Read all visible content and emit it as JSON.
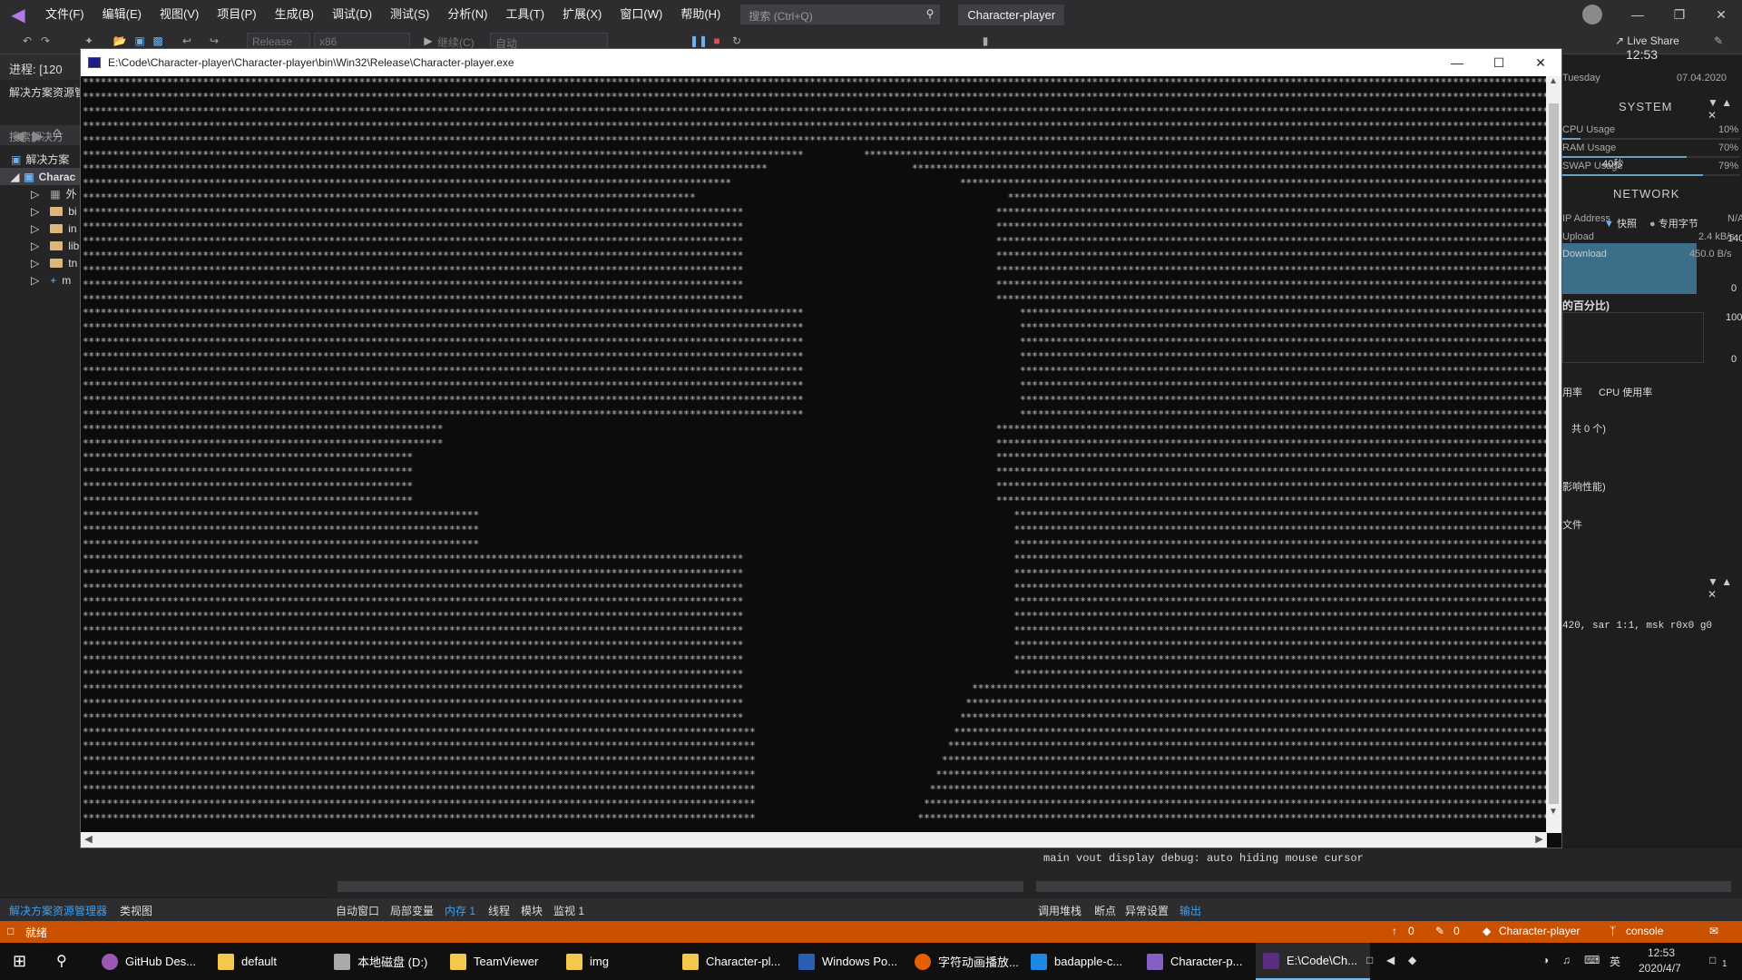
{
  "vs": {
    "menu": [
      "文件(F)",
      "编辑(E)",
      "视图(V)",
      "项目(P)",
      "生成(B)",
      "调试(D)",
      "测试(S)",
      "分析(N)",
      "工具(T)",
      "扩展(X)",
      "窗口(W)",
      "帮助(H)"
    ],
    "search_placeholder": "搜索 (Ctrl+Q)",
    "app_title": "Character-player",
    "live_share": "Live Share",
    "toolbar": {
      "config": "Release",
      "platform": "x86",
      "continue": "继续(C)",
      "auto": "自动"
    },
    "process_label": "进程:",
    "process_value": "[120",
    "solution": {
      "header": "解决方案资源管",
      "search": "搜索解决方",
      "items": [
        "解决方案",
        "Charac",
        "外",
        "bi",
        "in",
        "lib",
        "tn",
        "m"
      ]
    },
    "bottom_left_tabs": [
      "解决方案资源管理器",
      "类视图"
    ],
    "bottom_mid_tabs": [
      "自动窗口",
      "局部变量",
      "内存 1",
      "线程",
      "模块",
      "监视 1"
    ],
    "bottom_right_tabs": [
      "调用堆栈",
      "断点",
      "异常设置",
      "输出"
    ],
    "output_lines": [
      "main vout display debug: auto hiding mouse cursor"
    ],
    "status": {
      "ready": "就绪",
      "up": "0",
      "edit": "0",
      "project": "Character-player",
      "branch": "console"
    }
  },
  "console": {
    "title": "E:\\Code\\Character-player\\Character-player\\bin\\Win32\\Release\\Character-player.exe",
    "char": "*"
  },
  "rainmeter": {
    "time": "12:53",
    "day": "Tuesday",
    "date": "07.04.2020",
    "system_title": "SYSTEM",
    "cpu_label": "CPU Usage",
    "cpu_value": "10%",
    "ram_label": "RAM Usage",
    "ram_value": "70%",
    "swap_label": "SWAP Usage",
    "swap_value": "79%",
    "swap_extra": "40秒",
    "network_title": "NETWORK",
    "ip_label": "IP Address",
    "ip_value": "N/A",
    "snap": "快照",
    "bytes": "专用字节",
    "upload_label": "Upload",
    "upload_value": "2.4 kB/s",
    "upload_scale": "140",
    "download_label": "Download",
    "download_value": "450.0 B/s",
    "zero1": "0",
    "percent_title": "的百分比)",
    "hundred": "100",
    "zero2": "0",
    "usage1": "用率",
    "usage2": "CPU 使用率",
    "count": "共 0 个)",
    "impact": "影响性能)",
    "file": "文件",
    "diag_text": "420, sar 1:1, msk r0x0 g0"
  },
  "taskbar": {
    "items": [
      "GitHub Des...",
      "default",
      "本地磁盘 (D:)",
      "TeamViewer",
      "img",
      "Character-pl...",
      "Windows Po...",
      "字符动画播放...",
      "badapple-c...",
      "Character-p...",
      "E:\\Code\\Ch..."
    ],
    "ime": "英",
    "time": "12:53",
    "date": "2020/4/7",
    "notif": "1"
  },
  "colors": {
    "status_bar": "#ca5100",
    "accent": "#3ca0f0",
    "console_bg": "#0c0c0c"
  }
}
